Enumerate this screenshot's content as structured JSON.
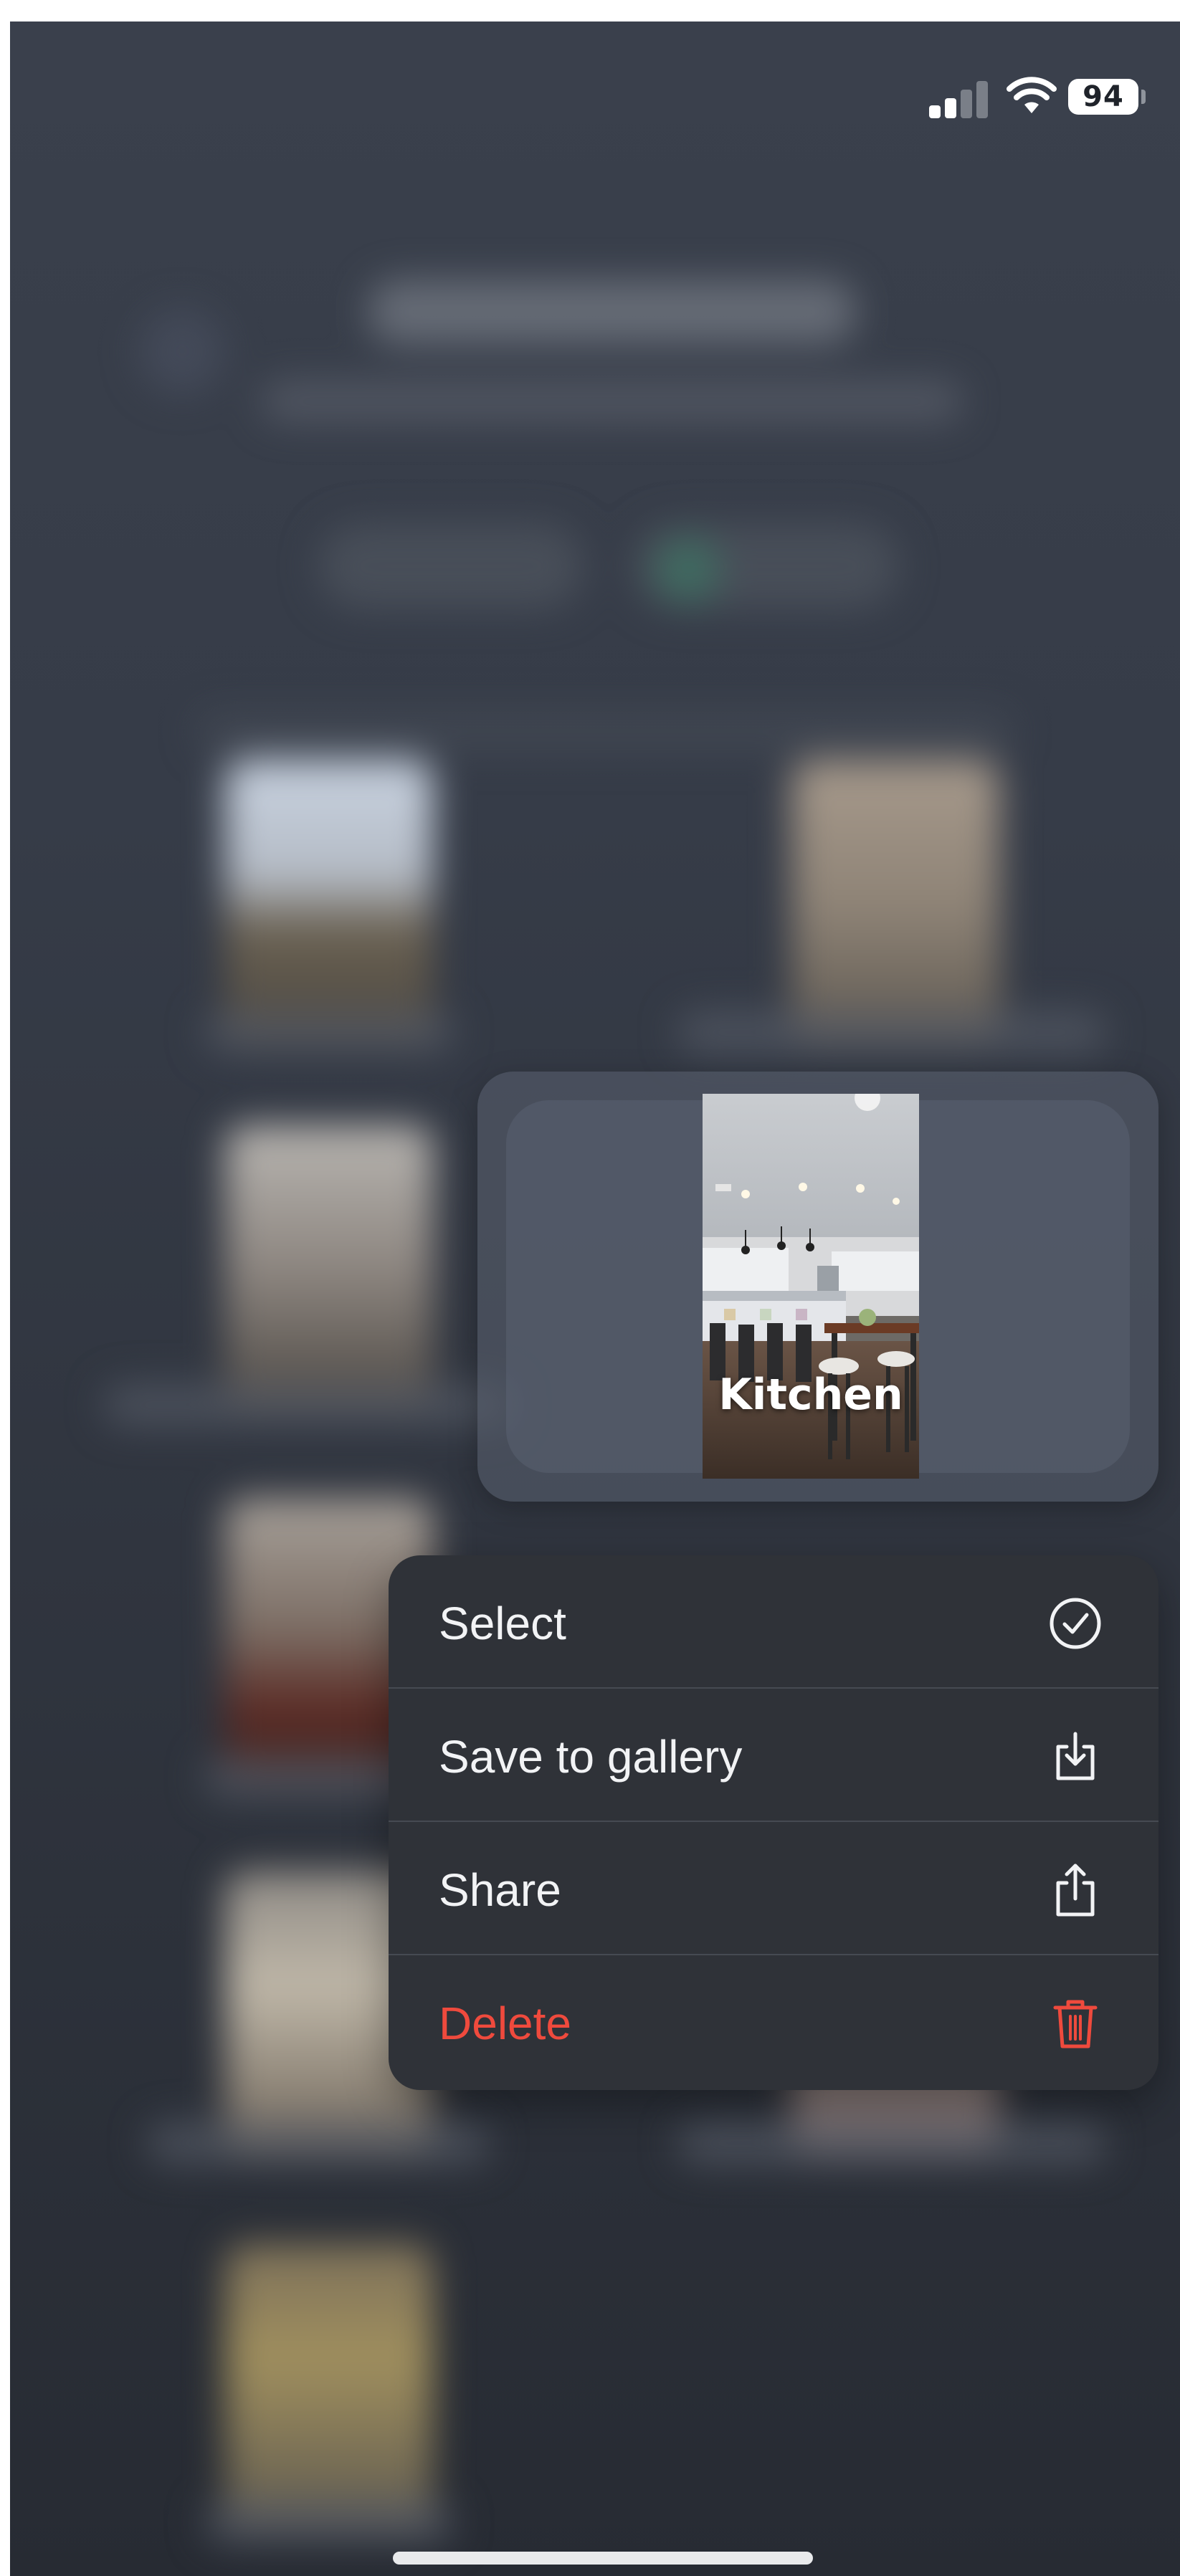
{
  "status_bar": {
    "battery_percent": "94",
    "signal_bars_active": 2,
    "signal_bars_total": 4,
    "wifi_icon": "wifi-icon"
  },
  "preview": {
    "label": "Kitchen",
    "image_description_icon": "kitchen-photo"
  },
  "menu": {
    "items": [
      {
        "label": "Select",
        "icon": "checkmark-circle-icon",
        "destructive": false
      },
      {
        "label": "Save to gallery",
        "icon": "download-tray-icon",
        "destructive": false
      },
      {
        "label": "Share",
        "icon": "share-icon",
        "destructive": false
      },
      {
        "label": "Delete",
        "icon": "trash-icon",
        "destructive": true
      }
    ]
  },
  "colors": {
    "menu_background": "#2f3238",
    "menu_text": "#f2f3f5",
    "destructive": "#ef4a3d",
    "screen_background": "#363c48"
  }
}
